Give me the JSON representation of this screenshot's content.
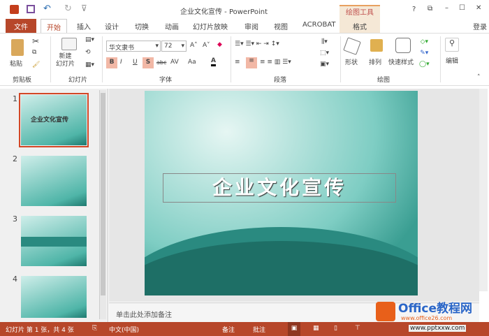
{
  "titlebar": {
    "title": "企业文化宣传 - PowerPoint",
    "context_tab_group": "绘图工具",
    "help": "?",
    "restore": "⧉",
    "minimize": "–",
    "maximize": "☐",
    "close": "✕"
  },
  "tabs": [
    "文件",
    "开始",
    "插入",
    "设计",
    "切换",
    "动画",
    "幻灯片放映",
    "审阅",
    "视图",
    "ACROBAT",
    "格式"
  ],
  "login": "登录",
  "ribbon": {
    "clipboard": {
      "label": "剪贴板",
      "paste": "粘贴"
    },
    "slides": {
      "label": "幻灯片",
      "new_slide": "新建\n幻灯片"
    },
    "font": {
      "label": "字体",
      "font_name": "华文隶书",
      "font_size": "72",
      "bold": "B",
      "italic": "I",
      "underline": "U",
      "shadow": "S",
      "strike": "abc",
      "spacing": "AV",
      "case": "Aa",
      "color": "A"
    },
    "paragraph": {
      "label": "段落"
    },
    "drawing": {
      "label": "绘图",
      "shapes": "形状",
      "arrange": "排列",
      "quick_styles": "快速样式"
    },
    "editing": {
      "label": "编辑"
    }
  },
  "slides": [
    {
      "num": "1",
      "title": "企业文化宣传"
    },
    {
      "num": "2"
    },
    {
      "num": "3"
    },
    {
      "num": "4"
    }
  ],
  "slide": {
    "title": "企业文化宣传"
  },
  "notes_placeholder": "单击此处添加备注",
  "status": {
    "slide_info": "幻灯片 第 1 张，共 4 张",
    "language": "中文(中国)",
    "notes": "备注",
    "comments": "批注"
  },
  "watermark": {
    "brand": "Office教程网",
    "url1": "www.office26.com",
    "url2": "www.pptxxw.com"
  },
  "colors": {
    "accent": "#b7472a",
    "context": "#f5e8d6"
  }
}
